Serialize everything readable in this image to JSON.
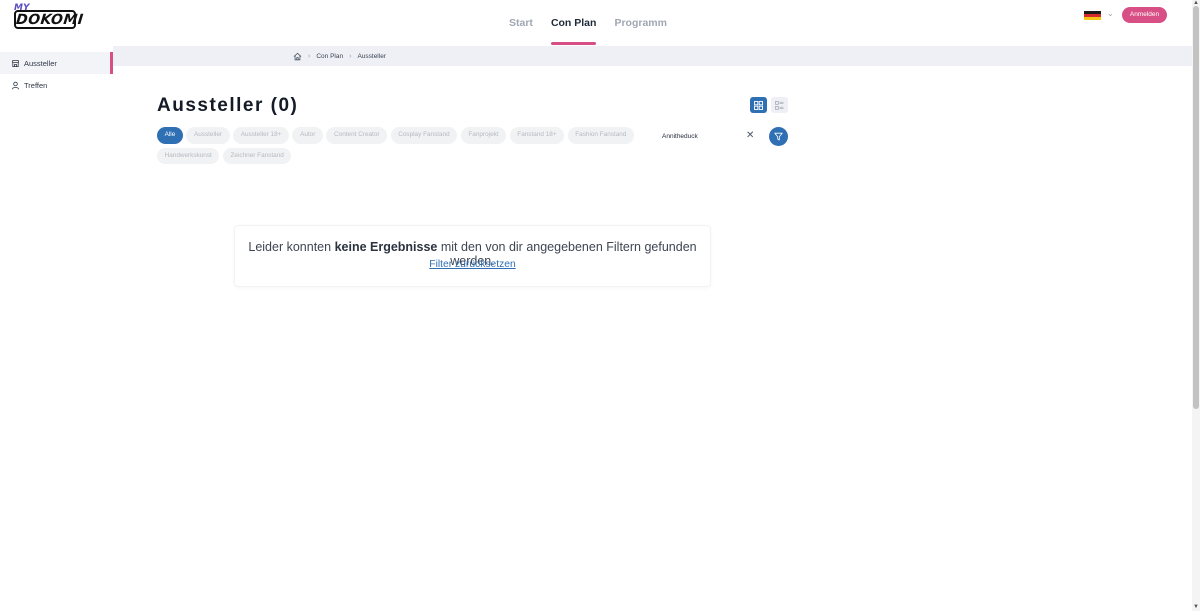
{
  "header": {
    "logo_small": "MY",
    "logo_main": "DOKOMI",
    "nav": [
      {
        "label": "Start",
        "active": false
      },
      {
        "label": "Con Plan",
        "active": true
      },
      {
        "label": "Programm",
        "active": false
      }
    ],
    "language_flag": "germany-flag-icon",
    "login_label": "Anmelden"
  },
  "sidebar": {
    "items": [
      {
        "label": "Aussteller",
        "icon": "store-icon",
        "active": true
      },
      {
        "label": "Treffen",
        "icon": "user-icon",
        "active": false
      }
    ]
  },
  "breadcrumb": {
    "home_icon": "home-icon",
    "items": [
      "Con Plan",
      "Aussteller"
    ]
  },
  "main": {
    "title": "Aussteller (0)",
    "view_modes": [
      "grid-view-icon",
      "list-view-icon"
    ],
    "filters": [
      {
        "label": "Alle",
        "active": true
      },
      {
        "label": "Aussteller",
        "active": false
      },
      {
        "label": "Aussteller 18+",
        "active": false
      },
      {
        "label": "Autor",
        "active": false
      },
      {
        "label": "Content Creator",
        "active": false
      },
      {
        "label": "Cosplay Fanstand",
        "active": false
      },
      {
        "label": "Fanprojekt",
        "active": false
      },
      {
        "label": "Fanstand 18+",
        "active": false
      },
      {
        "label": "Fashion Fanstand",
        "active": false
      },
      {
        "label": "Handwerkskunst",
        "active": false
      },
      {
        "label": "Zeichner Fanstand",
        "active": false
      }
    ],
    "search": {
      "value": "Annitheduck",
      "placeholder": ""
    },
    "empty_state": {
      "message_before": "Leider konnten ",
      "message_bold": "keine Ergebnisse",
      "message_after": " mit den von dir angegebenen Filtern gefunden werden.",
      "reset_link": "Filter zurücksetzen"
    }
  },
  "colors": {
    "accent_pink": "#d84f86",
    "primary_blue": "#2f6fb4",
    "breadcrumb_bg": "#eef0f6"
  }
}
